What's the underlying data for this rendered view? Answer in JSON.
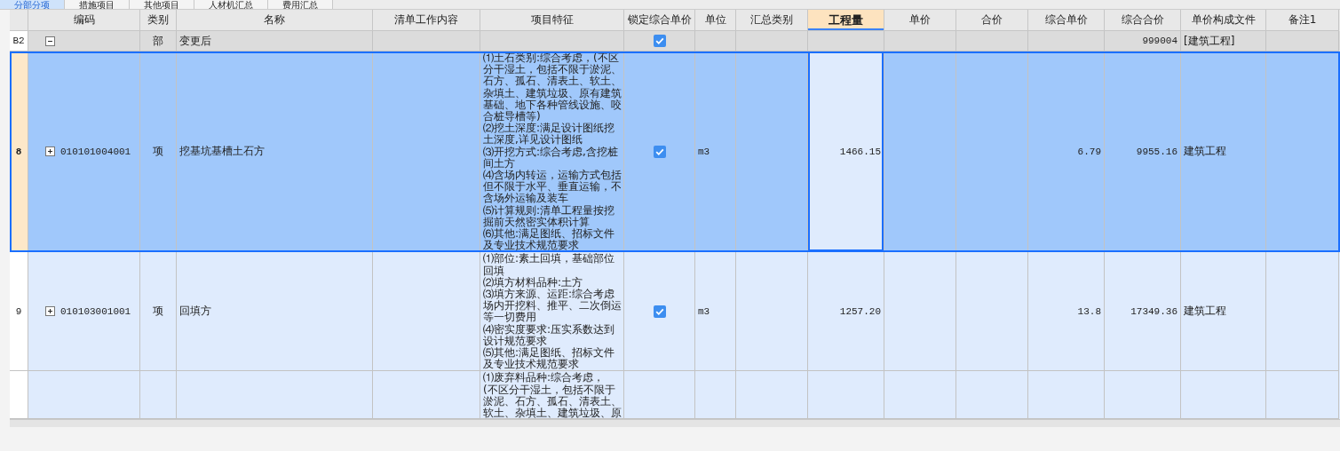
{
  "tabs": [
    {
      "label": "分部分项",
      "selected": true
    },
    {
      "label": "措施项目",
      "selected": false
    },
    {
      "label": "其他项目",
      "selected": false
    },
    {
      "label": "人材机汇总",
      "selected": false
    },
    {
      "label": "费用汇总",
      "selected": false
    }
  ],
  "columns": [
    {
      "label": "编码",
      "selected": false
    },
    {
      "label": "类别",
      "selected": false
    },
    {
      "label": "名称",
      "selected": false
    },
    {
      "label": "清单工作内容",
      "selected": false
    },
    {
      "label": "项目特征",
      "selected": false
    },
    {
      "label": "锁定综合单价",
      "selected": false
    },
    {
      "label": "单位",
      "selected": false
    },
    {
      "label": "汇总类别",
      "selected": false
    },
    {
      "label": "工程量",
      "selected": true
    },
    {
      "label": "单价",
      "selected": false
    },
    {
      "label": "合价",
      "selected": false
    },
    {
      "label": "综合单价",
      "selected": false
    },
    {
      "label": "综合合价",
      "selected": false
    },
    {
      "label": "单价构成文件",
      "selected": false
    },
    {
      "label": "备注1",
      "selected": false
    }
  ],
  "rows": [
    {
      "kind": "section",
      "row_number": "B2",
      "selected": false,
      "expanded": true,
      "code": "",
      "type": "部",
      "name": "变更后",
      "features": "",
      "locked": true,
      "unit": "",
      "quantity": "",
      "composite_unit_price": "",
      "composite_total": "999004",
      "pricing_file": "[建筑工程]"
    },
    {
      "kind": "item",
      "row_number": "8",
      "selected": true,
      "expanded": false,
      "code": "010101004001",
      "type": "项",
      "name": "挖基坑基槽土石方",
      "features": "⑴土石类别:综合考虑，(不区分干湿土，包括不限于淤泥、石方、孤石、清表土、软土、杂填土、建筑垃圾、原有建筑基础、地下各种管线设施、咬合桩导槽等)\n⑵挖土深度:满足设计图纸挖土深度,详见设计图纸\n⑶开挖方式:综合考虑,含挖桩间土方\n⑷含场内转运，运输方式包括但不限于水平、垂直运输，不含场外运输及装车\n⑸计算规则:清单工程量按挖掘前天然密实体积计算\n⑹其他:满足图纸、招标文件及专业技术规范要求",
      "locked": true,
      "unit": "m3",
      "quantity": "1466.15",
      "composite_unit_price": "6.79",
      "composite_total": "9955.16",
      "pricing_file": "建筑工程"
    },
    {
      "kind": "item",
      "row_number": "9",
      "selected": false,
      "expanded": false,
      "code": "010103001001",
      "type": "项",
      "name": "回填方",
      "features": "⑴部位:素土回填，基础部位回填\n⑵填方材料品种:土方\n⑶填方来源、运距:综合考虑场内开挖料、推平、二次倒运等一切费用\n⑷密实度要求:压实系数达到设计规范要求\n⑸其他:满足图纸、招标文件及专业技术规范要求",
      "locked": true,
      "unit": "m3",
      "quantity": "1257.20",
      "composite_unit_price": "13.8",
      "composite_total": "17349.36",
      "pricing_file": "建筑工程"
    },
    {
      "kind": "partial",
      "row_number": "",
      "selected": false,
      "features": "⑴废弃料品种:综合考虑，\n(不区分干湿土，包括不限于淤泥、石方、孤石、清表土、软土、杂填土、建筑垃圾、原"
    }
  ]
}
